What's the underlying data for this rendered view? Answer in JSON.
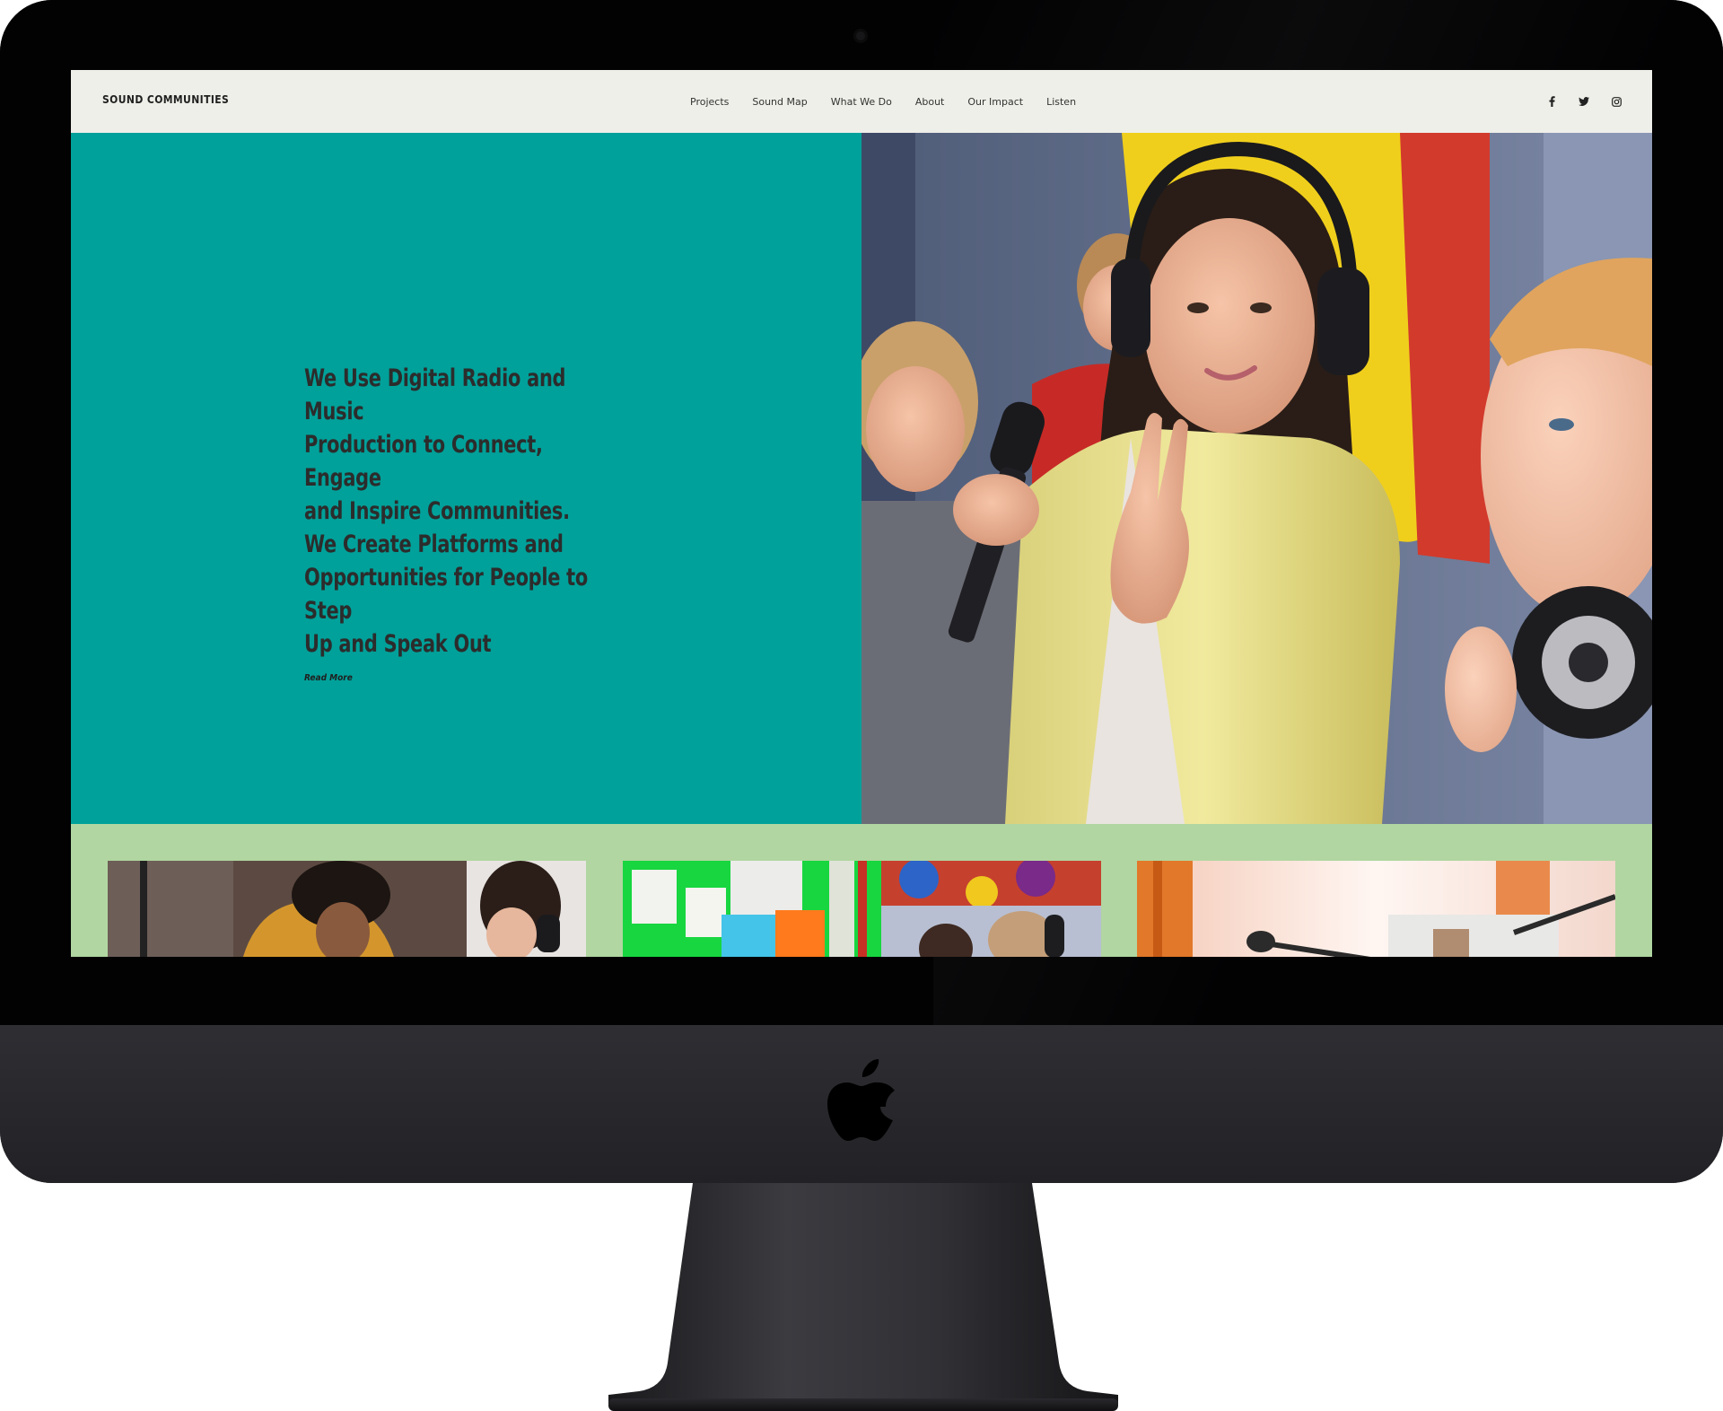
{
  "site": {
    "brand": "SOUND COMMUNITIES",
    "nav": [
      {
        "label": "Projects"
      },
      {
        "label": "Sound Map"
      },
      {
        "label": "What We Do"
      },
      {
        "label": "About"
      },
      {
        "label": "Our Impact"
      },
      {
        "label": "Listen"
      }
    ],
    "social": [
      "facebook-icon",
      "twitter-icon",
      "instagram-icon"
    ]
  },
  "hero": {
    "heading_line1": "We Use Digital Radio and Music",
    "heading_line2": "Production to Connect, Engage",
    "heading_line3": "and Inspire Communities.",
    "heading_line4": "We Create Platforms and",
    "heading_line5": "Opportunities for People to Step",
    "heading_line6": "Up and Speak Out",
    "read_more": "Read More",
    "colors": {
      "accent": "#00a19a",
      "strip": "#b1d6a1",
      "nav_bg": "#efefe9"
    }
  }
}
